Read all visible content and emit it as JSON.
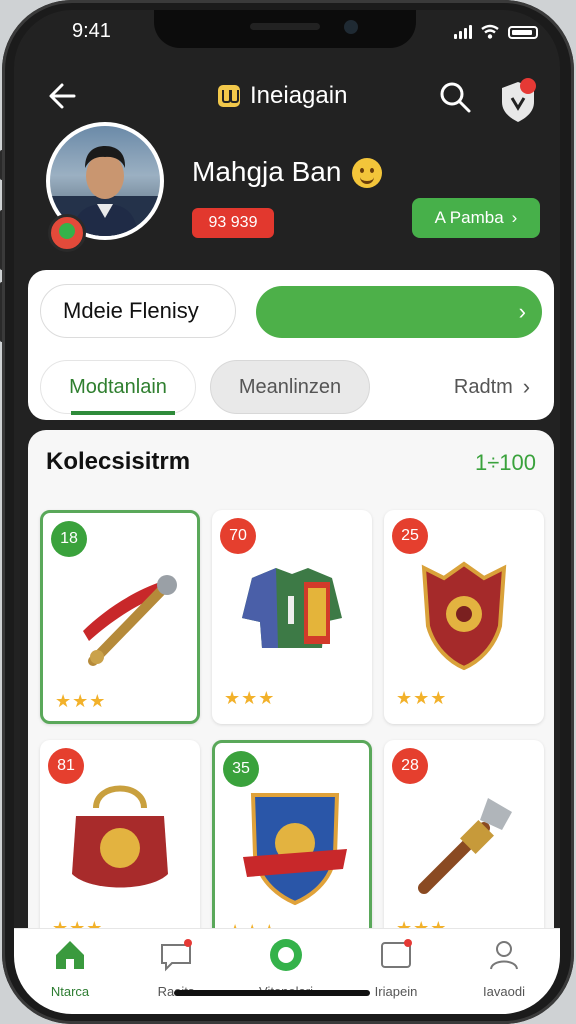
{
  "status_bar": {
    "time": "9:41"
  },
  "header": {
    "title": "Ineiagain"
  },
  "profile": {
    "name": "Mahgja Ban",
    "points": "93 939",
    "action_label": "A Pamba"
  },
  "top_panel": {
    "input_text": "Mdeie Flenisy",
    "tabs": [
      {
        "label": "Modtanlain"
      },
      {
        "label": "Meanlinzen"
      },
      {
        "label": "Radtm"
      }
    ]
  },
  "collection": {
    "title": "Kolecsisitrm",
    "count": "1÷100",
    "items": [
      {
        "level": "18",
        "level_color": "green",
        "stars": 3,
        "icon": "red-scroll-mace-icon"
      },
      {
        "level": "70",
        "level_color": "red",
        "stars": 3,
        "icon": "jersey-icon"
      },
      {
        "level": "25",
        "level_color": "red",
        "stars": 3,
        "icon": "shield-icon"
      },
      {
        "level": "81",
        "level_color": "red",
        "stars": 3,
        "icon": "crest-bag-icon"
      },
      {
        "level": "35",
        "level_color": "green",
        "stars": 3,
        "icon": "team-crest-icon"
      },
      {
        "level": "28",
        "level_color": "red",
        "stars": 3,
        "icon": "torch-icon"
      }
    ]
  },
  "bottom_nav": [
    {
      "label": "Ntarca",
      "icon": "home-icon"
    },
    {
      "label": "Raeits",
      "icon": "chat-icon"
    },
    {
      "label": "Vitonolari",
      "icon": "whatsapp-icon"
    },
    {
      "label": "Iriapein",
      "icon": "message-icon"
    },
    {
      "label": "Iavaodi",
      "icon": "profile-icon"
    }
  ],
  "colors": {
    "accent_green": "#47b04a",
    "accent_red": "#e2382e",
    "header_bg": "#222222"
  }
}
